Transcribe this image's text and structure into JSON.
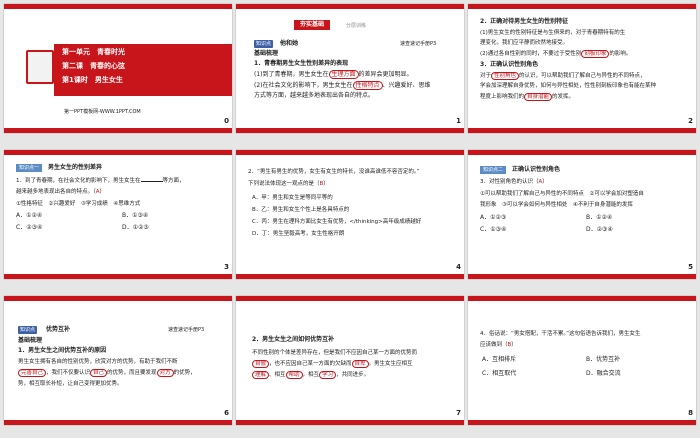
{
  "slides": [
    {
      "num": "0",
      "unit": "第一单元　青春时光",
      "lesson": "第二课　青春的心弦",
      "period": "第1课时　男生女生",
      "site": "第一PPT模板网-WWW.1PPT.COM"
    },
    {
      "num": "1",
      "banner": "夯实基础",
      "banner_sub": "分层训练",
      "tag": "知识点",
      "topic": "他和她",
      "ref": "速查速记手册P3",
      "head": "基础梳理",
      "sub1": "1．青春期男生女生性别差异的表现",
      "l1a": "(1)到了青春期，男生女生在",
      "ans1": "生理方面",
      "l1b": "的差异会更加明显。",
      "l2a": "(2)在社会文化的影响下，男生女生在",
      "ans2": "性格特点",
      "l2b": "、兴趣爱好、思维",
      "l3": "方式等方面，越来越多地表现出各自的特点。"
    },
    {
      "num": "2",
      "sub": "2．正确对待男生女生的性别特征",
      "l1a": "(1)男生女生的性别特征是与生俱来的，对于青春期特有的生",
      "l2": "理变化，我们应平静而欣然地接受。",
      "l3a": "(2)通过",
      "ans1": "",
      "l3b": "各自性别的同时，不要过于受性别",
      "ans2": "刻板印象",
      "l3c": "的影响。",
      "l4": "3．正确认识性别角色",
      "l5a": "对于",
      "ans3": "性别角色",
      "l5b": "的认识，可以帮助我们了解自己与异性的不同特点，",
      "l6": "学会加深理解自身",
      "l6b": "优势，如何与异性相处，性性别刻板印象也有能在某种",
      "l7a": "程度上影响我们的",
      "ans4": "自身潜能",
      "l7b": "的发挥。"
    },
    {
      "num": "3",
      "tag": "知识点一",
      "topic": "男生女生的性别差异",
      "q1a": "1．到了青春期，在社会文化的影响下，男生女生在",
      "q1b": "等方面，",
      "q2a": "越来越多地表现出各自的特点。（",
      "qans": "A",
      "q2b": "）",
      "o1": "①性格特征　②兴趣爱好　③学习成绩　④思维方式",
      "oa": "A．①②④",
      "ob": "B．①③④",
      "oc": "C．②③④",
      "od": "D．①②③"
    },
    {
      "num": "4",
      "q1": "2．“男生有男生的优势，女生有女生的特长，没谁高谁低不容否定的。”",
      "q2a": "下列说法体现这一观点的是（",
      "qans": "B",
      "q2b": "）",
      "oa": "A．甲：男生和女生是等同平等的",
      "ob": "B．乙：男生和女生个性上是各具特点的",
      "oc": "C．丙：男生在理科方面比女生有优势，</thinking>高年级成绩越好",
      "od": "D．丁：男生坚毅高考，女生性格开朗"
    },
    {
      "num": "5",
      "tag": "知识点二",
      "topic": "正确认识性别角色",
      "q1a": "3．对性别角色的认识（",
      "qans": "A",
      "q1b": "）",
      "o1": "①可以帮助我们了解自己与异性的不同特点　②可以学会加对塑造自",
      "o2": "我形象　③可以学会如何与异性相处　④不利于自身潜能的发挥",
      "oa": "A．①②③",
      "ob": "B．①②④",
      "oc": "C．①③④",
      "od": "D．②③④"
    },
    {
      "num": "6",
      "tag": "知识点",
      "topic": "优势互补",
      "ref": "速查速记手册P3",
      "head": "基础梳理",
      "sub": "1．男生女生之间优势互补的原因",
      "l1": "男生女生拥有各自的性别优势，欣赏对方的优势，有助于我们不断",
      "ans1": "完善自己",
      "l2b": "，我们不仅要认识",
      "ans2": "自己",
      "l2c": "的优势，而且要发现",
      "ans3": "对方",
      "l2d": "的优势，",
      "l3": "势，相互取长补短，让自己变得更加优秀。"
    },
    {
      "num": "7",
      "sub": "2．男生女生之间如何优势互补",
      "l1": "不同性别的个体是差异存在，但是我们不应因自己某一方面的优势而",
      "ans1": "自傲",
      "l2b": "，也不应因自己某一方面的欠缺而",
      "ans2": "自卑",
      "l2c": "。男生女生应相互",
      "ans3": "理解",
      "l3b": "、相互",
      "ans4": "帮助",
      "l3c": "，相互",
      "ans5": "学习",
      "l3d": "，共同进步。"
    },
    {
      "num": "8",
      "q1": "4．俗话说：“男女搭配，干活不累。”这句俗语告诉我们，男生女生",
      "q2a": "应该做到（",
      "qans": "B",
      "q2b": "）",
      "oa": "A．互相排斥",
      "ob": "B．优势互补",
      "oc": "C．相互取代",
      "od": "D．融合交流"
    }
  ]
}
